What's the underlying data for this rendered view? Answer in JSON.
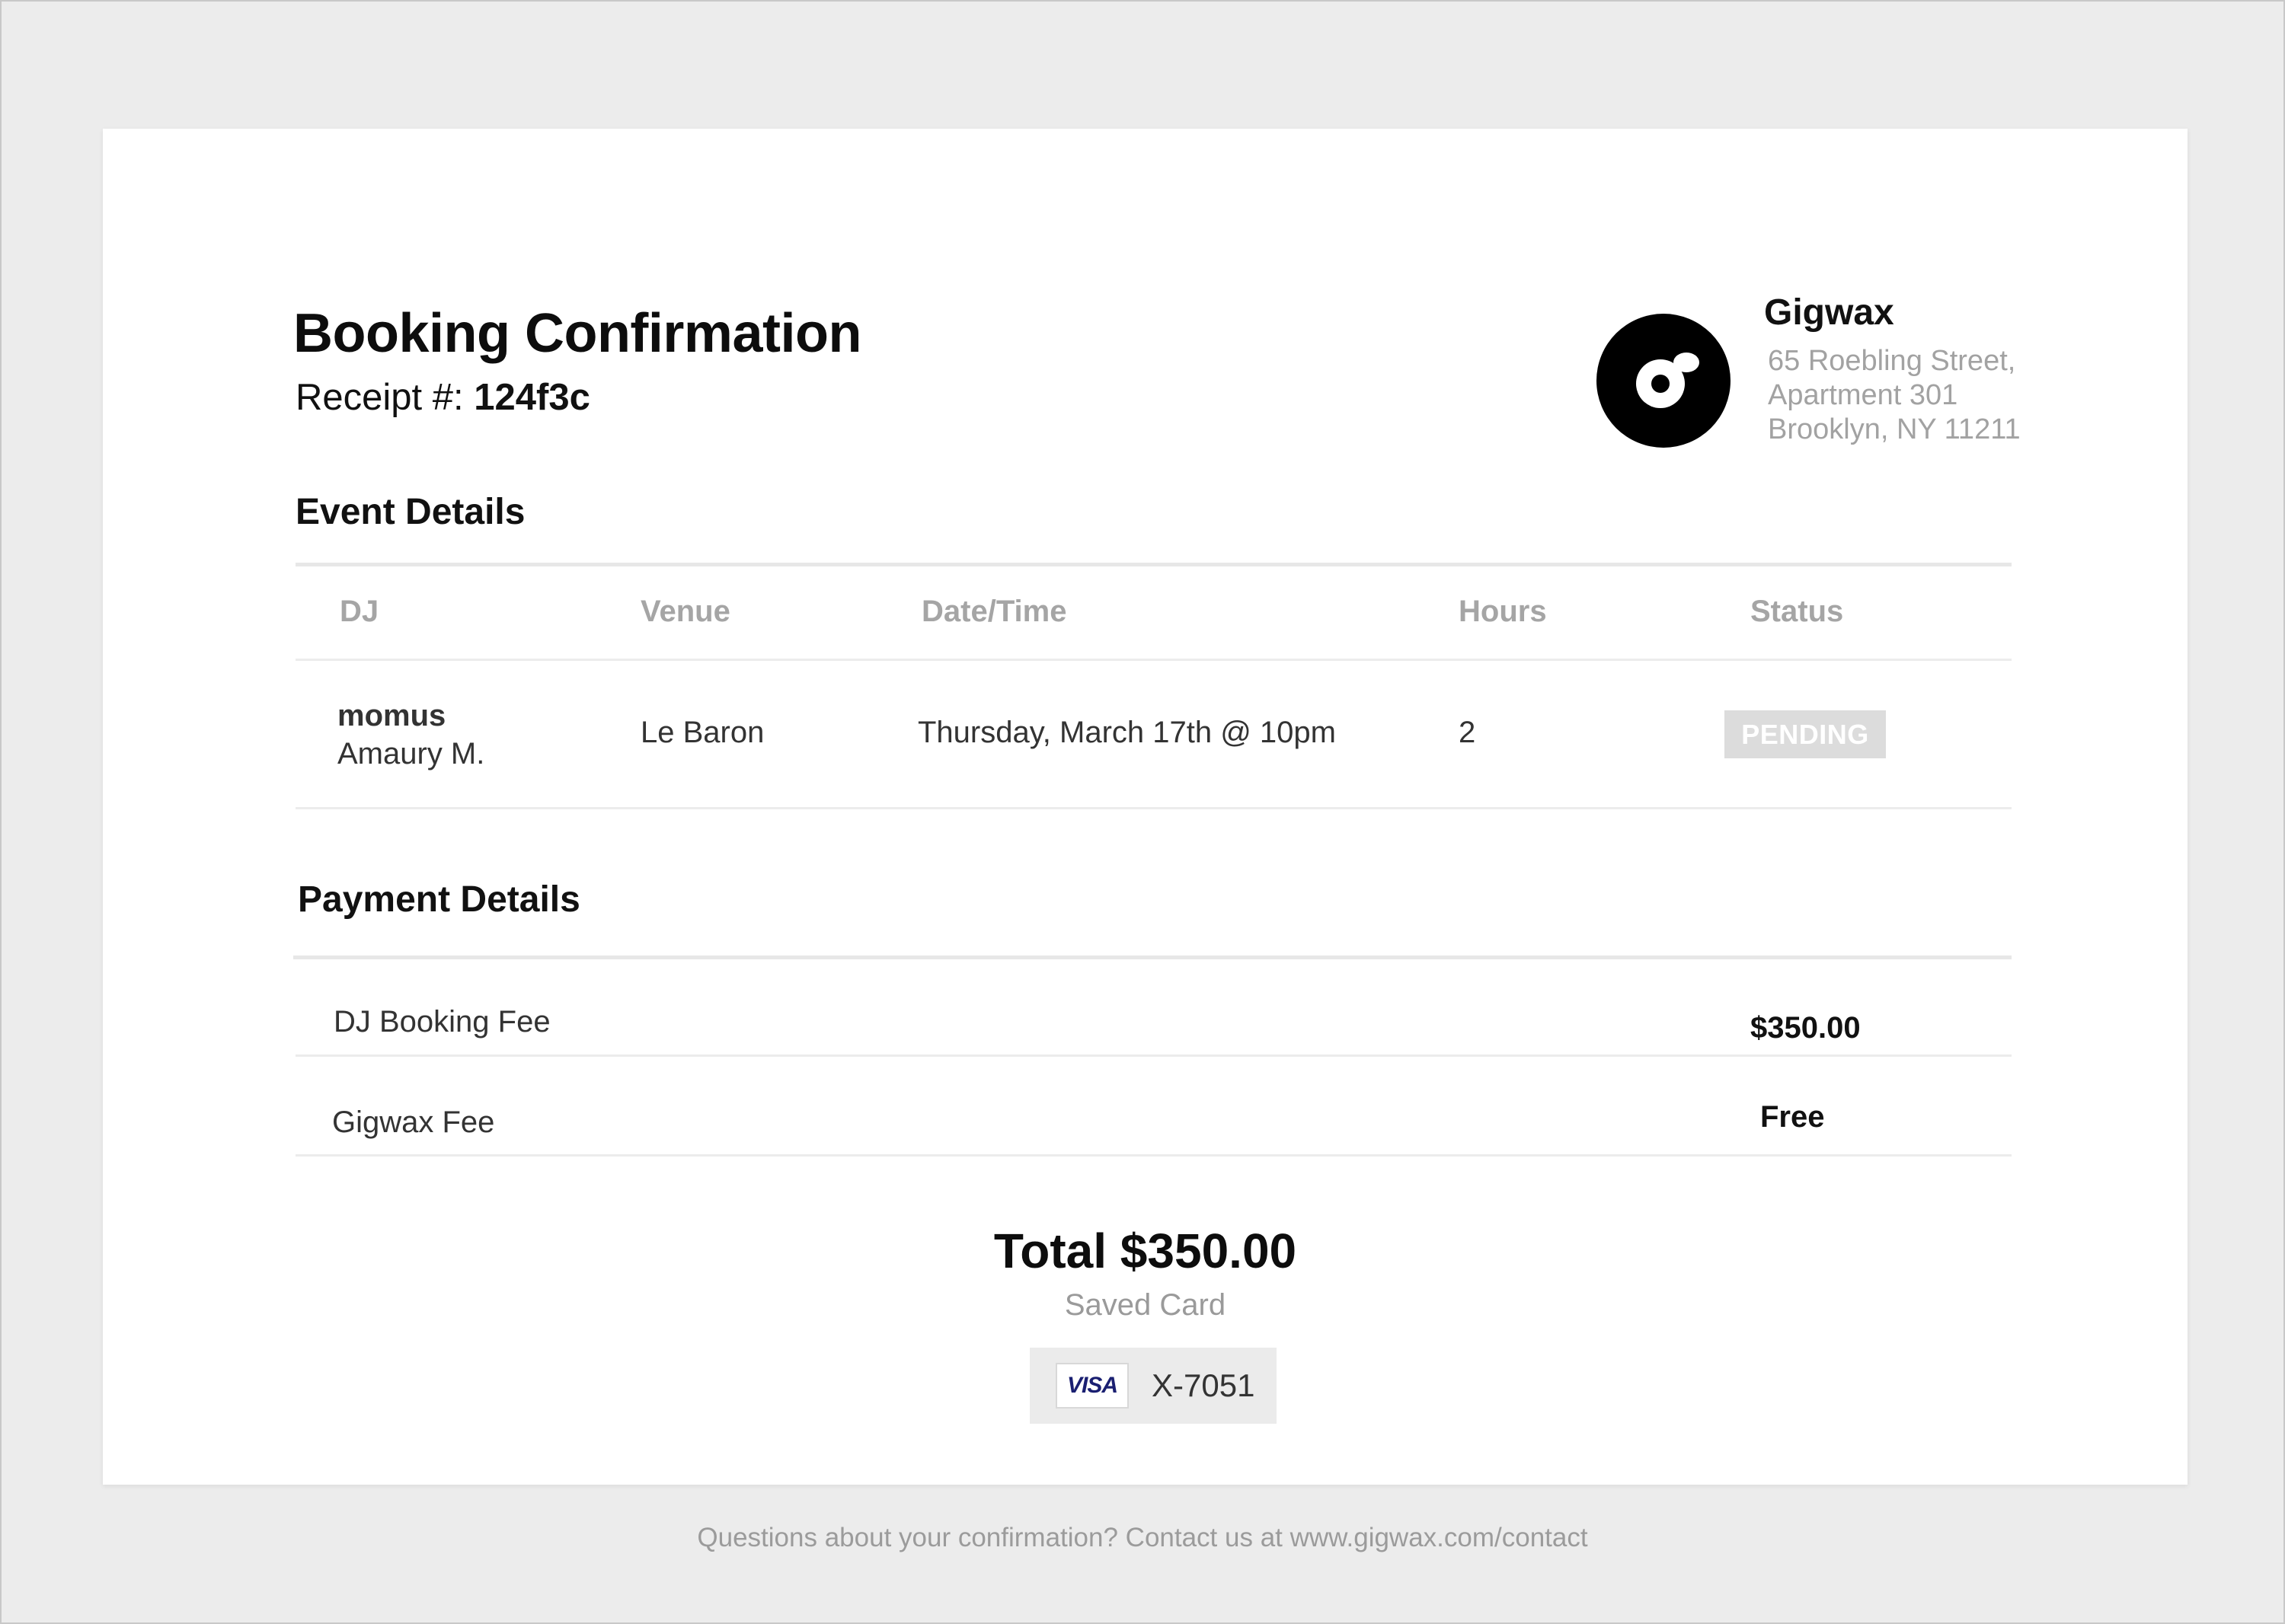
{
  "header": {
    "title": "Booking Confirmation",
    "receipt_label": "Receipt #:",
    "receipt_number": "124f3c"
  },
  "company": {
    "logo_icon": "vinyl-record-icon",
    "name": "Gigwax",
    "address_line1": "65 Roebling Street,",
    "address_line2": "Apartment 301",
    "address_line3": "Brooklyn, NY 11211"
  },
  "event": {
    "section_title": "Event Details",
    "columns": [
      "DJ",
      "Venue",
      "Date/Time",
      "Hours",
      "Status"
    ],
    "row": {
      "dj_handle": "momus",
      "dj_name": "Amaury M.",
      "venue": "Le Baron",
      "datetime": "Thursday, March 17th @ 10pm",
      "hours": "2",
      "status": "PENDING"
    }
  },
  "payment": {
    "section_title": "Payment Details",
    "items": [
      {
        "label": "DJ Booking Fee",
        "amount": "$350.00"
      },
      {
        "label": "Gigwax Fee",
        "amount": "Free"
      }
    ],
    "total": "Total $350.00",
    "method_label": "Saved Card",
    "card_brand": "VISA",
    "card_number": "X-7051"
  },
  "footer": {
    "text": "Questions about your confirmation? Contact us at www.gigwax.com/contact"
  },
  "colors": {
    "background": "#ececec",
    "card": "#ffffff",
    "muted_text": "#a2a2a2",
    "badge_bg": "#dcdcdc",
    "visa_blue": "#1a1f71"
  }
}
